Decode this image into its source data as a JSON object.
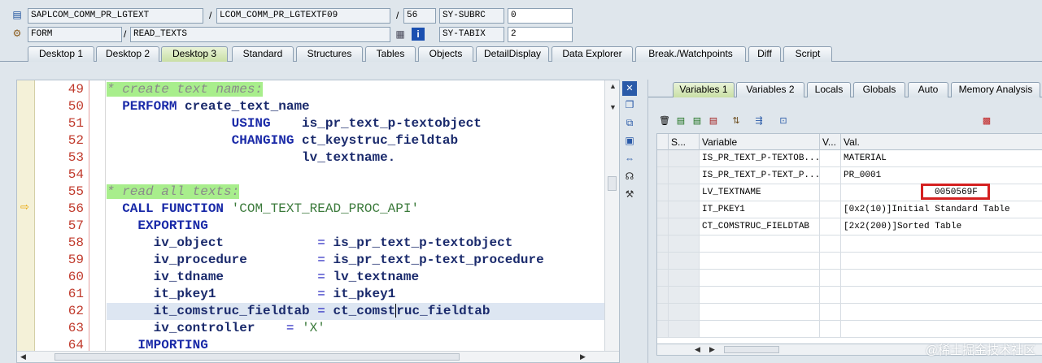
{
  "header": {
    "row1": {
      "program": "SAPLCOM_COMM_PR_LGTEXT",
      "include": "LCOM_COMM_PR_LGTEXTF09",
      "line": "56",
      "var_name": "SY-SUBRC",
      "var_value": "0"
    },
    "row2": {
      "event_type": "FORM",
      "event": "READ_TEXTS",
      "var_name": "SY-TABIX",
      "var_value": "2"
    },
    "slash": "/"
  },
  "tabs": [
    "Desktop 1",
    "Desktop 2",
    "Desktop 3",
    "Standard",
    "Structures",
    "Tables",
    "Objects",
    "DetailDisplay",
    "Data Explorer",
    "Break./Watchpoints",
    "Diff",
    "Script"
  ],
  "code_lines": [
    {
      "num": "49"
    },
    {
      "num": "50"
    },
    {
      "num": "51"
    },
    {
      "num": "52"
    },
    {
      "num": "53"
    },
    {
      "num": "54"
    },
    {
      "num": "55"
    },
    {
      "num": "56"
    },
    {
      "num": "57"
    },
    {
      "num": "58"
    },
    {
      "num": "59"
    },
    {
      "num": "60"
    },
    {
      "num": "61"
    },
    {
      "num": "62"
    },
    {
      "num": "63"
    },
    {
      "num": "64"
    }
  ],
  "code": {
    "l49": "* create text names:",
    "l50_kw": "PERFORM",
    "l50_id": "create_text_name",
    "l51_kw": "USING",
    "l51_id": "is_pr_text_p-textobject",
    "l52_kw": "CHANGING",
    "l52_id": "ct_keystruc_fieldtab",
    "l53_id": "lv_textname.",
    "l55": "* read all texts:",
    "l56_kw": "CALL FUNCTION",
    "l56_str": "'COM_TEXT_READ_PROC_API'",
    "l57_kw": "EXPORTING",
    "l58_a": "iv_object",
    "l58_b": "is_pr_text_p-textobject",
    "l59_a": "iv_procedure",
    "l59_b": "is_pr_text_p-text_procedure",
    "l60_a": "iv_tdname",
    "l60_b": "lv_textname",
    "l61_a": "it_pkey1",
    "l61_b": "it_pkey1",
    "l62_a": "it_comstruc_fieldtab",
    "l62_b1": "ct_comst",
    "l62_b2": "ruc_fieldtab",
    "l63_a": "iv_controller",
    "l63_str": "'X'",
    "l64_kw": "IMPORTING",
    "eq": "="
  },
  "right_tabs": [
    "Variables 1",
    "Variables 2",
    "Locals",
    "Globals",
    "Auto",
    "Memory Analysis"
  ],
  "grid": {
    "headers": {
      "s": "S...",
      "variable": "Variable",
      "v": "V...",
      "val": "Val."
    },
    "rows": [
      {
        "variable": "IS_PR_TEXT_P-TEXTOB...",
        "value": "MATERIAL"
      },
      {
        "variable": "IS_PR_TEXT_P-TEXT_P...",
        "value": "PR_0001"
      },
      {
        "variable": "LV_TEXTNAME",
        "value": "0050569F"
      },
      {
        "variable": "IT_PKEY1",
        "value": "[0x2(10)]Initial Standard Table"
      },
      {
        "variable": "CT_COMSTRUC_FIELDTAB",
        "value": "[2x2(200)]Sorted Table"
      }
    ]
  },
  "watermark": "@稀土掘金技术社区",
  "colors": {
    "comment_bg": "#a8ee8c",
    "highlight_line": "#dde6f2",
    "active_tab": "#c9dfa5",
    "line_number": "#c0392b",
    "red_box": "#d42020"
  }
}
